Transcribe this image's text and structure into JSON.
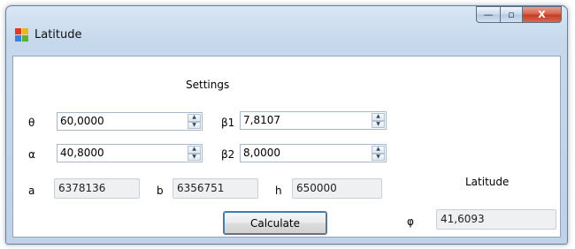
{
  "window": {
    "title": "Latitude",
    "buttons": {
      "minimize": "—",
      "maximize": "▫",
      "close": "X"
    }
  },
  "settings": {
    "heading": "Settings",
    "theta": {
      "label": "θ",
      "value": "60,0000"
    },
    "alpha": {
      "label": "α",
      "value": "40,8000"
    },
    "beta1": {
      "label": "β1",
      "value": "7,8107"
    },
    "beta2": {
      "label": "β2",
      "value": "8,0000"
    }
  },
  "constants": {
    "a": {
      "label": "a",
      "value": "6378136"
    },
    "b": {
      "label": "b",
      "value": "6356751"
    },
    "h": {
      "label": "h",
      "value": "650000"
    }
  },
  "result": {
    "heading": "Latitude",
    "label": "φ",
    "value": "41,6093"
  },
  "actions": {
    "calculate": "Calculate"
  },
  "icons": {
    "spin_up": "▲",
    "spin_down": "▼"
  }
}
